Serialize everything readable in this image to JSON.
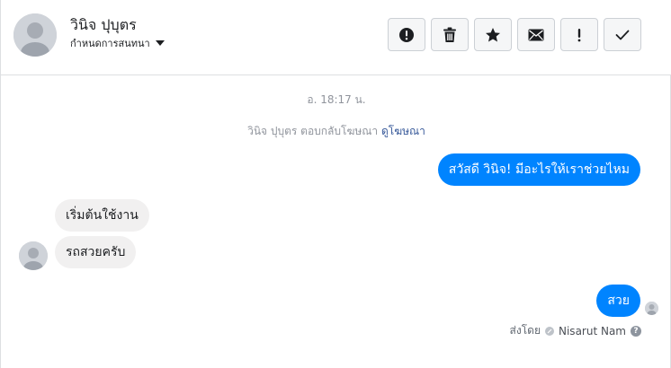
{
  "conversation": {
    "contact_name": "วินิจ ปุบุตร",
    "assign_label": "กำหนดการสนทนา",
    "toolbar": [
      {
        "name": "mark-spam-button",
        "icon": "alert-circle-icon"
      },
      {
        "name": "delete-button",
        "icon": "trash-icon"
      },
      {
        "name": "star-button",
        "icon": "star-icon"
      },
      {
        "name": "mark-unread-button",
        "icon": "envelope-icon"
      },
      {
        "name": "follow-up-button",
        "icon": "exclamation-icon"
      },
      {
        "name": "mark-done-button",
        "icon": "checkmark-icon"
      }
    ]
  },
  "thread": {
    "timestamp": "อ. 18:17 น.",
    "notice_text": "วินิจ ปุบุตร ตอบกลับโฆษณา",
    "notice_link": "ดูโฆษณา",
    "messages": [
      {
        "direction": "out",
        "text": "สวัสดี วินิจ! มีอะไรให้เราช่วยไหม"
      },
      {
        "direction": "in",
        "text": "เริ่มต้นใช้งาน"
      },
      {
        "direction": "in",
        "text": "รถสวยครับ"
      },
      {
        "direction": "out",
        "text": "สวย"
      }
    ],
    "sent_by_label": "ส่งโดย",
    "agent_name": "Nisarut Nam"
  },
  "colors": {
    "outgoing_bubble": "#0084ff",
    "incoming_bubble": "#f1f0f0",
    "link": "#365899",
    "muted_text": "#90949c"
  }
}
